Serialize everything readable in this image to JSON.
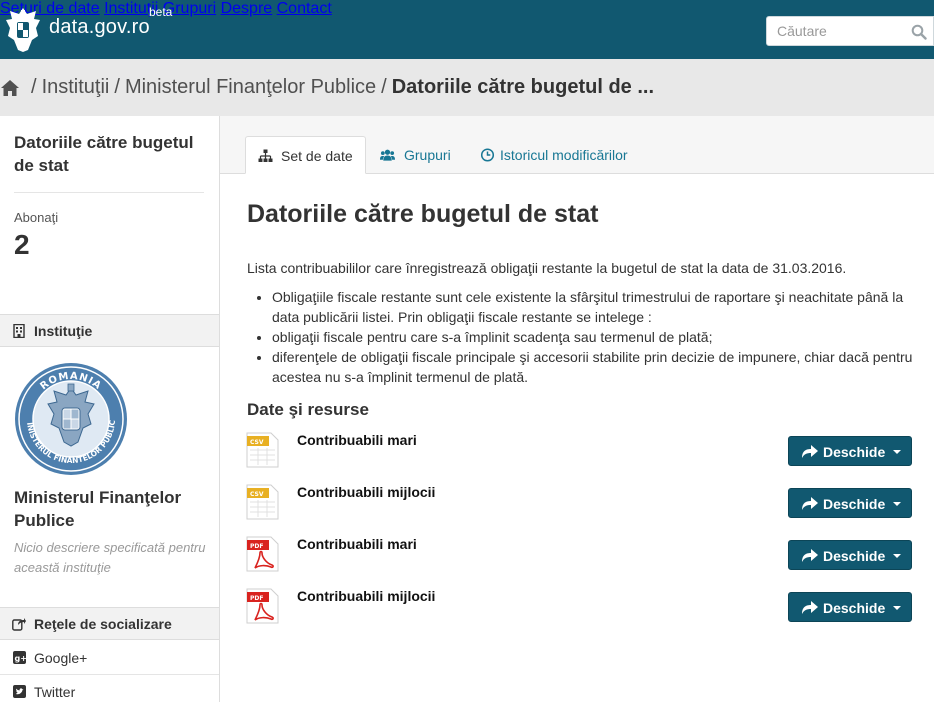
{
  "site": {
    "name": "data.gov.ro",
    "badge": "beta"
  },
  "nav": {
    "items": [
      "Seturi de date",
      "Instituţii",
      "Grupuri",
      "Despre",
      "Contact"
    ]
  },
  "search": {
    "placeholder": "Căutare"
  },
  "breadcrumb": {
    "items": [
      "Instituţii",
      "Ministerul Finanţelor Publice"
    ],
    "current": "Datoriile către bugetul de ..."
  },
  "sidebar": {
    "title": "Datoriile către bugetul de stat",
    "followers_label": "Abonaţi",
    "followers_count": "2",
    "org_section": "Instituţie",
    "org_name": "Ministerul Finanţelor Publice",
    "org_description": "Nicio descriere specificată pentru această instituţie",
    "social_section": "Reţele de socializare",
    "social_links": [
      "Google+",
      "Twitter"
    ],
    "seal_text_top": "ROMANIA",
    "seal_text_bottom": "MINISTERUL FINANTELOR PUBLICE"
  },
  "tabs": [
    {
      "label": "Set de date",
      "icon": "sitemap-icon",
      "active": true
    },
    {
      "label": "Grupuri",
      "icon": "users-icon",
      "active": false
    },
    {
      "label": "Istoricul modificărilor",
      "icon": "clock-icon",
      "active": false
    }
  ],
  "dataset": {
    "title": "Datoriile către bugetul de stat",
    "intro": "Lista contribuabililor care înregistrează obligaţii restante la bugetul de stat la data de 31.03.2016.",
    "bullets": [
      "Obligaţiile fiscale restante sunt cele existente la sfârşitul trimestrului de raportare şi neachitate până la data publicării listei. Prin obligaţii fiscale restante se intelege :",
      "obligaţii fiscale pentru care s-a împlinit scadenţa sau termenul de plată;",
      "diferenţele de obligaţii fiscale principale şi accesorii stabilite prin decizie de impunere, chiar dacă pentru acestea nu s-a împlinit termenul de plată."
    ]
  },
  "resources": {
    "heading": "Date şi resurse",
    "button_label": "Deschide",
    "items": [
      {
        "name": "Contribuabili mari",
        "format": "CSV"
      },
      {
        "name": "Contribuabili mijlocii",
        "format": "CSV"
      },
      {
        "name": "Contribuabili mari",
        "format": "PDF"
      },
      {
        "name": "Contribuabili mijlocii",
        "format": "PDF"
      }
    ]
  },
  "colors": {
    "header": "#115870",
    "link": "#187794",
    "csv": "#e8b023",
    "pdf": "#d9231f",
    "button": "#115870"
  }
}
